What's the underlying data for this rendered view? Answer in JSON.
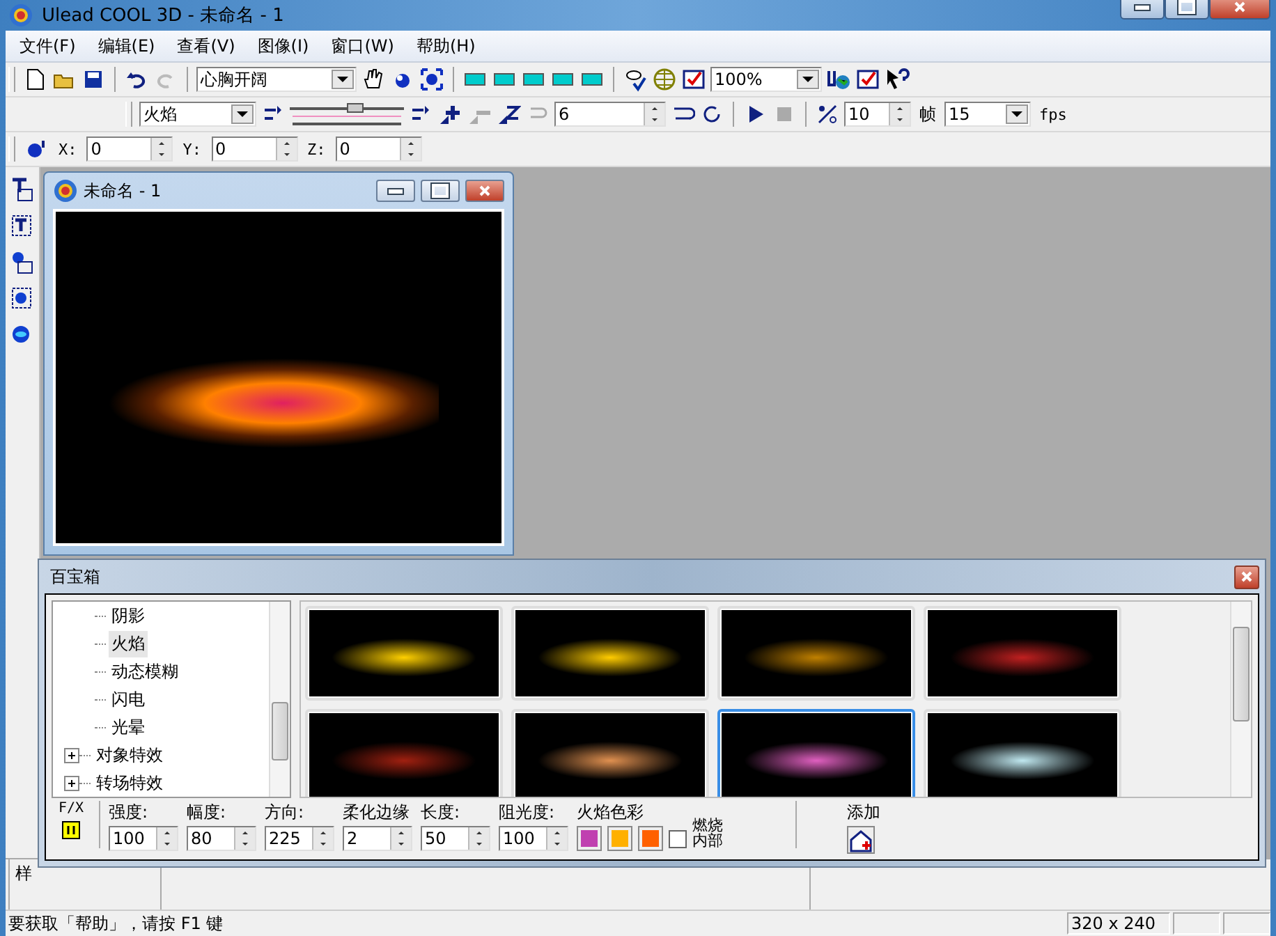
{
  "window": {
    "title": "Ulead COOL 3D - 未命名 - 1"
  },
  "menu": [
    {
      "label": "文件(F)"
    },
    {
      "label": "编辑(E)"
    },
    {
      "label": "查看(V)"
    },
    {
      "label": "图像(I)"
    },
    {
      "label": "窗口(W)"
    },
    {
      "label": "帮助(H)"
    }
  ],
  "toolbar": {
    "text_combo": "心胸开阔",
    "zoom_combo": "100%",
    "effect_combo": "火焰",
    "slider": {
      "level": 0.57
    },
    "spin_value": "6",
    "frames_value": "10",
    "frames_label": "帧",
    "fps_combo": "15",
    "fps_label": "fps"
  },
  "position": [
    {
      "label": "X:",
      "value": "0"
    },
    {
      "label": "Y:",
      "value": "0"
    },
    {
      "label": "Z:",
      "value": "0"
    }
  ],
  "document": {
    "title": "未命名 - 1"
  },
  "easy_palette": {
    "title": "百宝箱",
    "tree": [
      {
        "kind": "leaf",
        "label": "阴影",
        "selected": false
      },
      {
        "kind": "leaf",
        "label": "火焰",
        "selected": true
      },
      {
        "kind": "leaf",
        "label": "动态模糊",
        "selected": false
      },
      {
        "kind": "leaf",
        "label": "闪电",
        "selected": false
      },
      {
        "kind": "leaf",
        "label": "光晕",
        "selected": false
      },
      {
        "kind": "group",
        "label": "对象特效",
        "expanded": false,
        "selected": false
      },
      {
        "kind": "group",
        "label": "转场特效",
        "expanded": false,
        "selected": false
      }
    ],
    "thumbnails": [
      {
        "selected": false
      },
      {
        "selected": false
      },
      {
        "selected": false
      },
      {
        "selected": false
      },
      {
        "selected": false
      },
      {
        "selected": false
      },
      {
        "selected": true
      },
      {
        "selected": false
      }
    ],
    "fx_label": "F/X",
    "params": [
      {
        "label": "强度:",
        "value": "100"
      },
      {
        "label": "幅度:",
        "value": "80"
      },
      {
        "label": "方向:",
        "value": "225"
      },
      {
        "label": "柔化边缘",
        "value": "2"
      },
      {
        "label": "长度:",
        "value": "50"
      },
      {
        "label": "阻光度:",
        "value": "100"
      }
    ],
    "color_label": "火焰色彩",
    "colors": [
      {
        "color": "#c040b0"
      },
      {
        "color": "#ffb000"
      },
      {
        "color": "#ff6000"
      }
    ],
    "burn_inside": {
      "label": "燃烧内部",
      "checked": false
    },
    "add_label": "添加"
  },
  "lower_panel": {
    "tab": "样"
  },
  "status_bar": {
    "help": "要获取「帮助」，请按 F1 键",
    "size": "320 x 240"
  }
}
